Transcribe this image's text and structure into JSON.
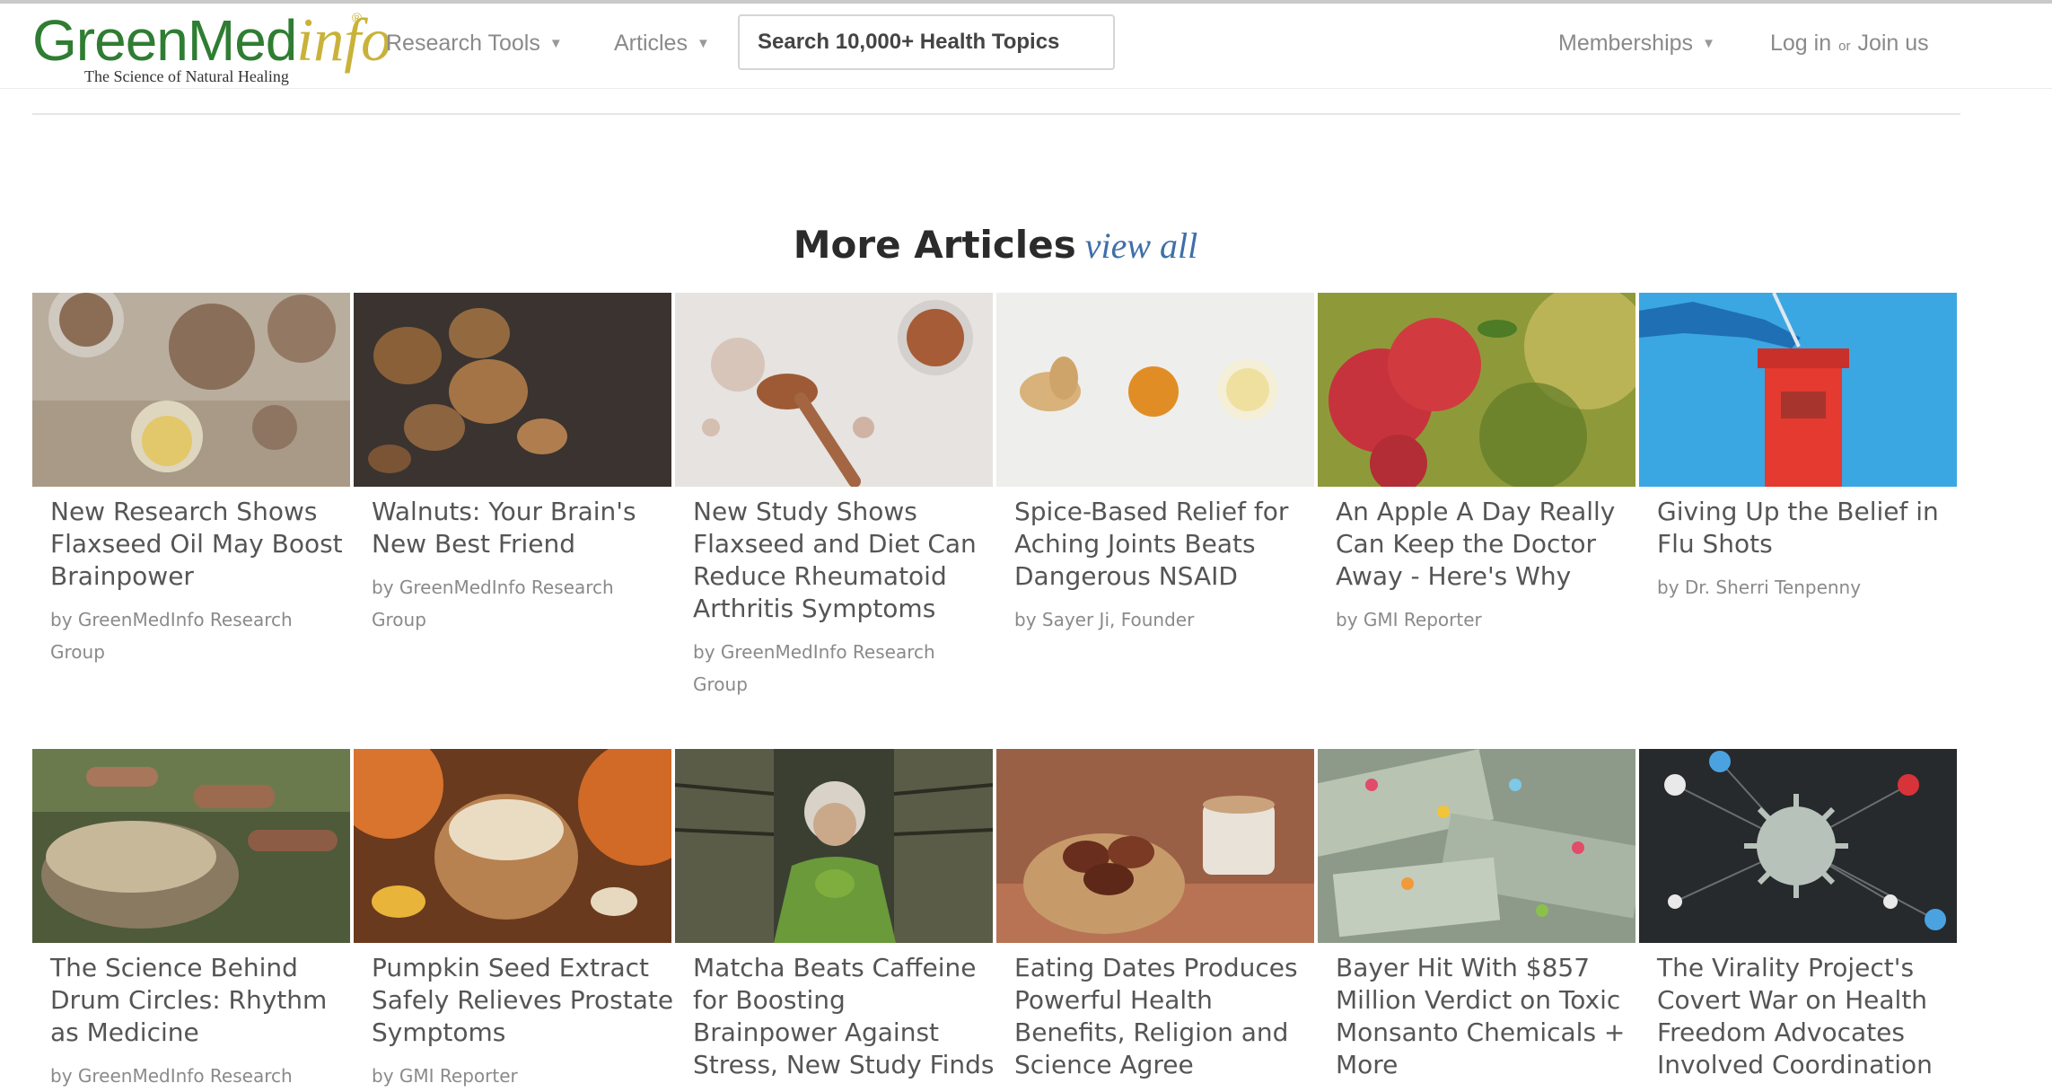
{
  "header": {
    "logo_main": "GreenMed",
    "logo_info": "info",
    "logo_reg": "®",
    "logo_tagline": "The Science of Natural Healing",
    "nav": {
      "research_tools": "Research Tools",
      "articles": "Articles",
      "memberships": "Memberships",
      "login": "Log in",
      "or": "or",
      "join": "Join us"
    },
    "search_placeholder": "Search 10,000+ Health Topics",
    "icons": {
      "dropdown": "chevron-down-icon"
    }
  },
  "section": {
    "title": "More Articles",
    "view_all": "view all"
  },
  "articles": [
    {
      "title_lines": [
        "New Research Shows",
        "Flaxseed Oil May Boost",
        "Brainpower"
      ],
      "by_lines": [
        "by GreenMedInfo Research",
        "Group"
      ],
      "image": "flaxseed-oil-image"
    },
    {
      "title_lines": [
        "Walnuts: Your Brain's",
        "New Best Friend"
      ],
      "by_lines": [
        "by GreenMedInfo Research",
        "Group"
      ],
      "image": "walnuts-image"
    },
    {
      "title_lines": [
        "New Study Shows",
        "Flaxseed and Diet Can",
        "Reduce Rheumatoid",
        "Arthritis Symptoms"
      ],
      "by_lines": [
        "by GreenMedInfo Research",
        "Group"
      ],
      "image": "flaxseed-spoon-image"
    },
    {
      "title_lines": [
        "Spice-Based Relief for",
        "Aching Joints Beats",
        "Dangerous NSAID"
      ],
      "by_lines": [
        "by Sayer Ji, Founder"
      ],
      "image": "ginger-turmeric-image"
    },
    {
      "title_lines": [
        "An Apple A Day Really",
        "Can Keep the Doctor",
        "Away - Here's Why"
      ],
      "by_lines": [
        "by GMI Reporter"
      ],
      "image": "apples-image"
    },
    {
      "title_lines": [
        "Giving Up the Belief in",
        "Flu Shots"
      ],
      "by_lines": [
        "by Dr. Sherri Tenpenny"
      ],
      "image": "sharps-container-image"
    },
    {
      "title_lines": [
        "The Science Behind",
        "Drum Circles: Rhythm",
        "as Medicine"
      ],
      "by_lines": [
        "by GreenMedInfo Research"
      ],
      "image": "drum-circle-image"
    },
    {
      "title_lines": [
        "Pumpkin Seed Extract",
        "Safely Relieves Prostate",
        "Symptoms"
      ],
      "by_lines": [
        "by GMI Reporter"
      ],
      "image": "pumpkin-seeds-image"
    },
    {
      "title_lines": [
        "Matcha Beats Caffeine",
        "for Boosting",
        "Brainpower Against",
        "Stress, New Study Finds"
      ],
      "by_lines": [],
      "image": "matcha-image"
    },
    {
      "title_lines": [
        "Eating Dates Produces",
        "Powerful Health",
        "Benefits, Religion and",
        "Science Agree"
      ],
      "by_lines": [],
      "image": "dates-image"
    },
    {
      "title_lines": [
        "Bayer Hit With $857",
        "Million Verdict on Toxic",
        "Monsanto Chemicals +",
        "More"
      ],
      "by_lines": [],
      "image": "money-pills-image"
    },
    {
      "title_lines": [
        "The Virality Project's",
        "Covert War on Health",
        "Freedom Advocates",
        "Involved Coordination"
      ],
      "by_lines": [],
      "image": "virus-network-image"
    }
  ]
}
